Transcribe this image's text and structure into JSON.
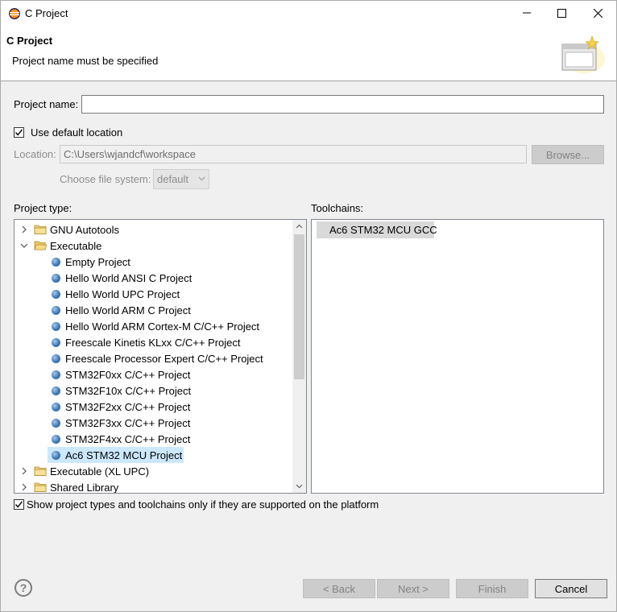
{
  "window": {
    "title": "C Project"
  },
  "banner": {
    "title": "C Project",
    "message": "Project name must be specified"
  },
  "project_name": {
    "label": "Project name:",
    "value": ""
  },
  "use_default_location": {
    "label": "Use default location",
    "checked": true
  },
  "location": {
    "label": "Location:",
    "value": "C:\\Users\\wjandcf\\workspace",
    "browse_label": "Browse..."
  },
  "file_system": {
    "label": "Choose file system:",
    "value": "default"
  },
  "project_type": {
    "label": "Project type:",
    "items": [
      {
        "label": "GNU Autotools",
        "kind": "folder",
        "level": 0,
        "expanded": false
      },
      {
        "label": "Executable",
        "kind": "folder",
        "level": 0,
        "expanded": true
      },
      {
        "label": "Empty Project",
        "kind": "leaf",
        "level": 1
      },
      {
        "label": "Hello World ANSI C Project",
        "kind": "leaf",
        "level": 1
      },
      {
        "label": "Hello World UPC Project",
        "kind": "leaf",
        "level": 1
      },
      {
        "label": "Hello World ARM C Project",
        "kind": "leaf",
        "level": 1
      },
      {
        "label": "Hello World ARM Cortex-M C/C++ Project",
        "kind": "leaf",
        "level": 1
      },
      {
        "label": "Freescale Kinetis KLxx C/C++ Project",
        "kind": "leaf",
        "level": 1
      },
      {
        "label": "Freescale Processor Expert C/C++ Project",
        "kind": "leaf",
        "level": 1
      },
      {
        "label": "STM32F0xx C/C++ Project",
        "kind": "leaf",
        "level": 1
      },
      {
        "label": "STM32F10x C/C++ Project",
        "kind": "leaf",
        "level": 1
      },
      {
        "label": "STM32F2xx C/C++ Project",
        "kind": "leaf",
        "level": 1
      },
      {
        "label": "STM32F3xx C/C++ Project",
        "kind": "leaf",
        "level": 1
      },
      {
        "label": "STM32F4xx C/C++ Project",
        "kind": "leaf",
        "level": 1
      },
      {
        "label": "Ac6 STM32 MCU Project",
        "kind": "leaf",
        "level": 1,
        "selected": true
      },
      {
        "label": "Executable (XL UPC)",
        "kind": "folder",
        "level": 0,
        "expanded": false
      },
      {
        "label": "Shared Library",
        "kind": "folder",
        "level": 0,
        "expanded": false
      }
    ]
  },
  "toolchains": {
    "label": "Toolchains:",
    "items": [
      "Ac6 STM32 MCU GCC"
    ]
  },
  "show_supported": {
    "label": "Show project types and toolchains only if they are supported on the platform",
    "checked": true
  },
  "footer": {
    "back_label": "< Back",
    "next_label": "Next >",
    "finish_label": "Finish",
    "cancel_label": "Cancel"
  },
  "colors": {
    "selection": "#cce8ff",
    "banner_bg": "#ffffff",
    "dialog_bg": "#f0f0f0"
  }
}
